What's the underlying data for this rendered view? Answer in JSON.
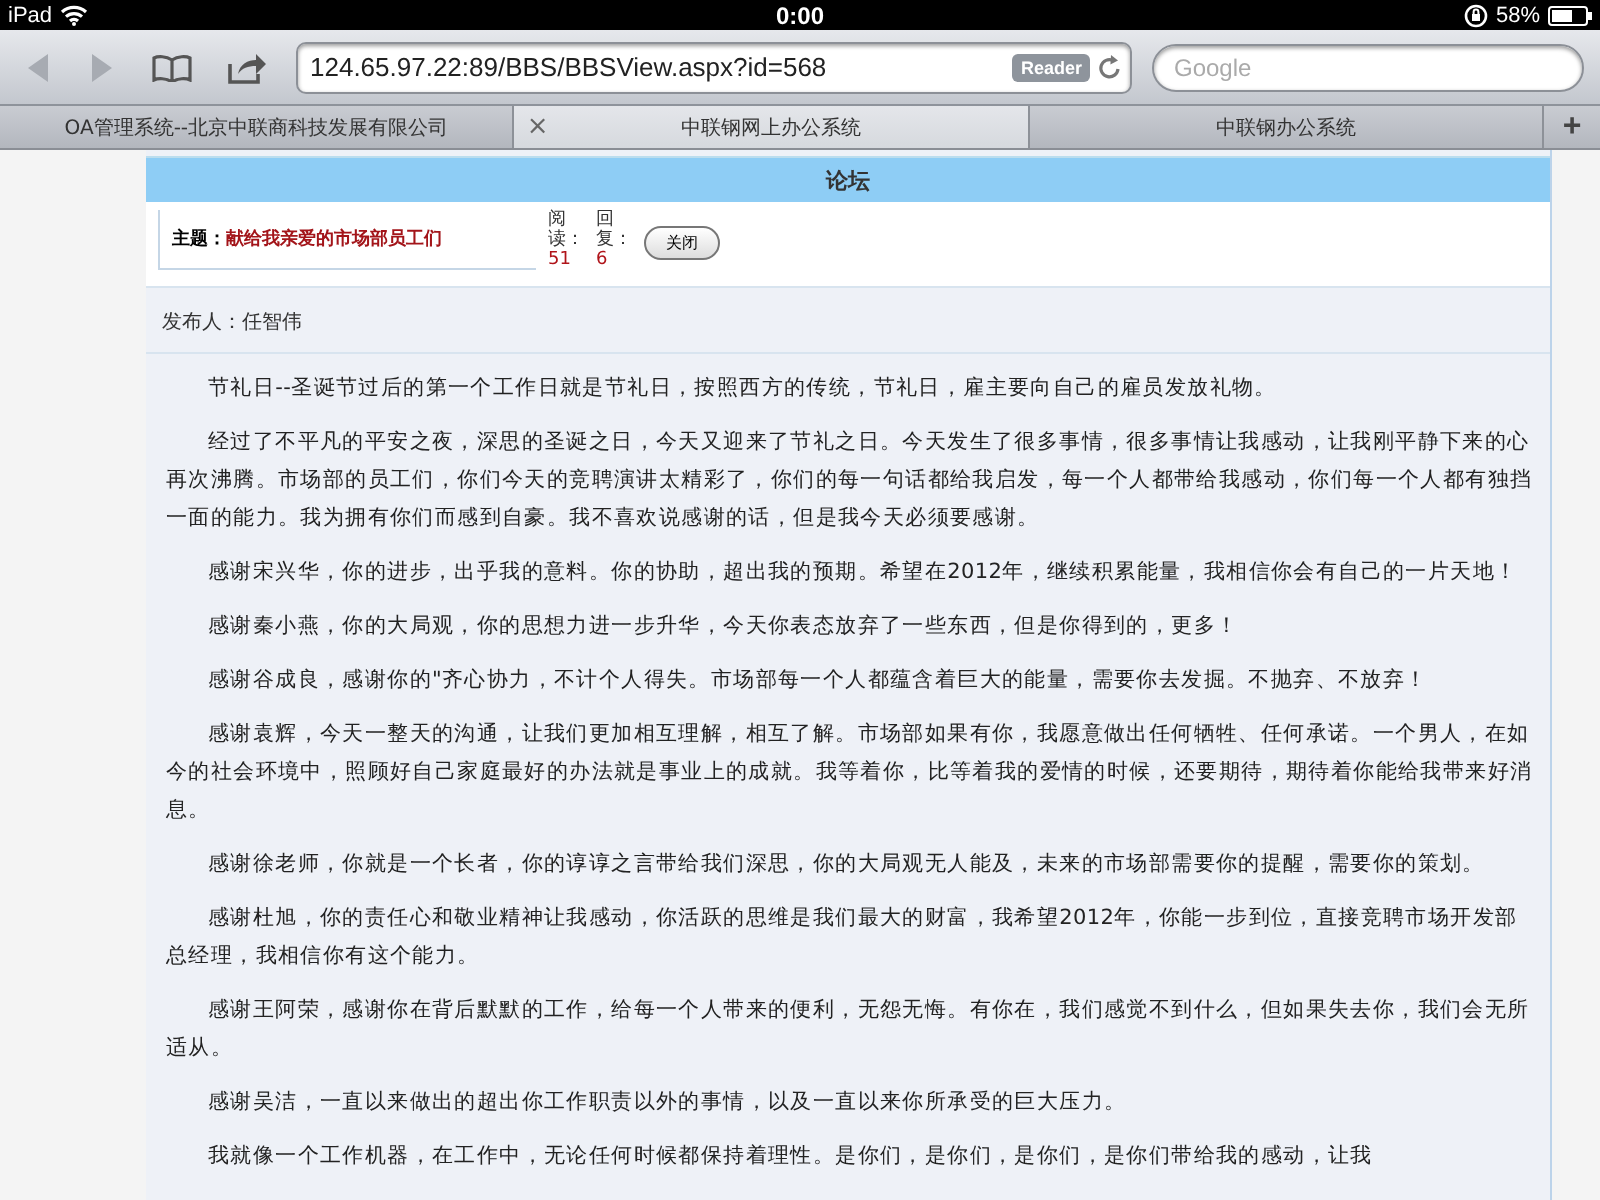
{
  "status_bar": {
    "device": "iPad",
    "time": "0:00",
    "battery": "58%"
  },
  "toolbar": {
    "back_disabled": true,
    "forward_disabled": true,
    "url": "124.65.97.22:89/BBS/BBSView.aspx?id=568",
    "reader": "Reader",
    "search": {
      "placeholder": "Google"
    }
  },
  "tabs": [
    {
      "label": "OA管理系统--北京中联商科技发展有限公司",
      "selected": false
    },
    {
      "label": "中联钢网上办公系统",
      "selected": true,
      "close": "×"
    },
    {
      "label": "中联钢办公系统",
      "selected": false
    }
  ],
  "new_tab": "+",
  "forum": {
    "title": "论坛",
    "subject_label": "主题：",
    "subject": "献给我亲爱的市场部员工们",
    "reads_label": "阅读：",
    "reads": "51",
    "replies_label": "回复：",
    "replies": "6",
    "close_button": "关闭",
    "author": "发布人：任智伟",
    "paragraphs": [
      "节礼日--圣诞节过后的第一个工作日就是节礼日，按照西方的传统，节礼日，雇主要向自己的雇员发放礼物。",
      "经过了不平凡的平安之夜，深思的圣诞之日，今天又迎来了节礼之日。今天发生了很多事情，很多事情让我感动，让我刚平静下来的心再次沸腾。市场部的员工们，你们今天的竞聘演讲太精彩了，你们的每一句话都给我启发，每一个人都带给我感动，你们每一个人都有独挡一面的能力。我为拥有你们而感到自豪。我不喜欢说感谢的话，但是我今天必须要感谢。",
      "感谢宋兴华，你的进步，出乎我的意料。你的协助，超出我的预期。希望在2012年，继续积累能量，我相信你会有自己的一片天地！",
      "感谢秦小燕，你的大局观，你的思想力进一步升华，今天你表态放弃了一些东西，但是你得到的，更多！",
      "感谢谷成良，感谢你的\"齐心协力，不计个人得失。市场部每一个人都蕴含着巨大的能量，需要你去发掘。不抛弃、不放弃！",
      "感谢袁辉，今天一整天的沟通，让我们更加相互理解，相互了解。市场部如果有你，我愿意做出任何牺牲、任何承诺。一个男人，在如今的社会环境中，照顾好自己家庭最好的办法就是事业上的成就。我等着你，比等着我的爱情的时候，还要期待，期待着你能给我带来好消息。",
      "感谢徐老师，你就是一个长者，你的谆谆之言带给我们深思，你的大局观无人能及，未来的市场部需要你的提醒，需要你的策划。",
      "感谢杜旭，你的责任心和敬业精神让我感动，你活跃的思维是我们最大的财富，我希望2012年，你能一步到位，直接竞聘市场开发部总经理，我相信你有这个能力。",
      "感谢王阿荣，感谢你在背后默默的工作，给每一个人带来的便利，无怨无悔。有你在，我们感觉不到什么，但如果失去你，我们会无所适从。",
      "感谢吴洁，一直以来做出的超出你工作职责以外的事情，以及一直以来你所承受的巨大压力。",
      "我就像一个工作机器，在工作中，无论任何时候都保持着理性。是你们，是你们，是你们，是你们带给我的感动，让我"
    ]
  }
}
